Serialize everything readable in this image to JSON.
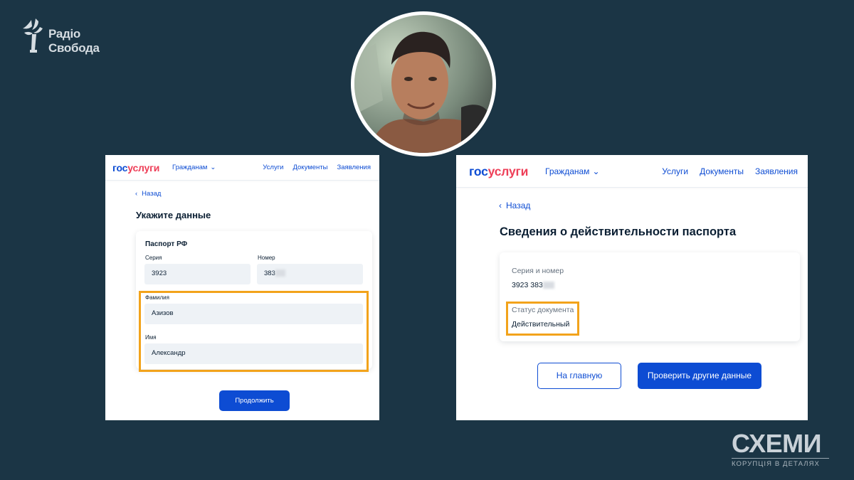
{
  "branding": {
    "radio_logo_line1": "Радіо",
    "radio_logo_line2": "Свобода",
    "schemy_title": "СХЕМИ",
    "schemy_subtitle": "КОРУПЦІЯ В ДЕТАЛЯХ",
    "accent_highlight": "#f2a31b",
    "background": "#1b3545"
  },
  "portrait": {
    "icon": "person-photo"
  },
  "left_screen": {
    "header": {
      "logo_part1": "гос",
      "logo_part2": "услуги",
      "citizens": "Гражданам",
      "nav": [
        "Услуги",
        "Документы",
        "Заявления"
      ]
    },
    "back": "Назад",
    "title": "Укажите данные",
    "card": {
      "section_title": "Паспорт РФ",
      "series_label": "Серия",
      "series_value": "3923",
      "number_label": "Номер",
      "number_value": "383",
      "surname_label": "Фамилия",
      "surname_value": "Азизов",
      "name_label": "Имя",
      "name_value": "Александр"
    },
    "continue_button": "Продолжить"
  },
  "right_screen": {
    "header": {
      "logo_part1": "гос",
      "logo_part2": "услуги",
      "citizens": "Гражданам",
      "nav": [
        "Услуги",
        "Документы",
        "Заявления"
      ]
    },
    "back": "Назад",
    "title": "Сведения о действительности паспорта",
    "card": {
      "series_number_label": "Серия и номер",
      "series_number_value": "3923 383",
      "status_label": "Статус документа",
      "status_value": "Действительный"
    },
    "home_button": "На главную",
    "check_other_button": "Проверить другие данные"
  },
  "colors": {
    "brand_blue": "#0d4cd3",
    "brand_red": "#ee3f58"
  }
}
